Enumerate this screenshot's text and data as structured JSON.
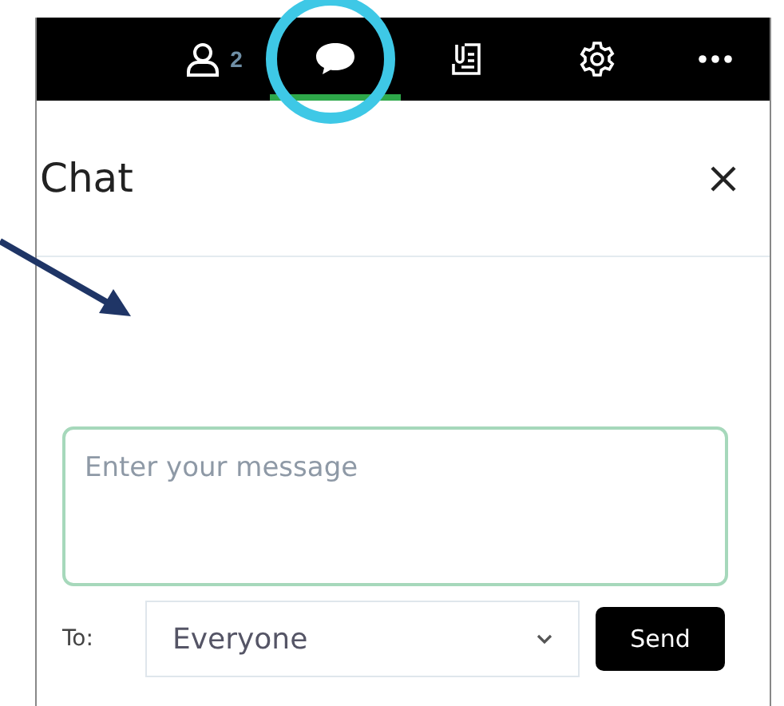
{
  "toolbar": {
    "tabs": [
      {
        "kind": "participants",
        "badge": "2",
        "selected": false
      },
      {
        "kind": "chat",
        "selected": true
      },
      {
        "kind": "notes",
        "selected": false
      },
      {
        "kind": "settings",
        "selected": false
      },
      {
        "kind": "more",
        "selected": false
      }
    ]
  },
  "panel": {
    "title": "Chat"
  },
  "composer": {
    "placeholder": "Enter your message",
    "to_label": "To:",
    "recipient": "Everyone",
    "send": "Send"
  }
}
